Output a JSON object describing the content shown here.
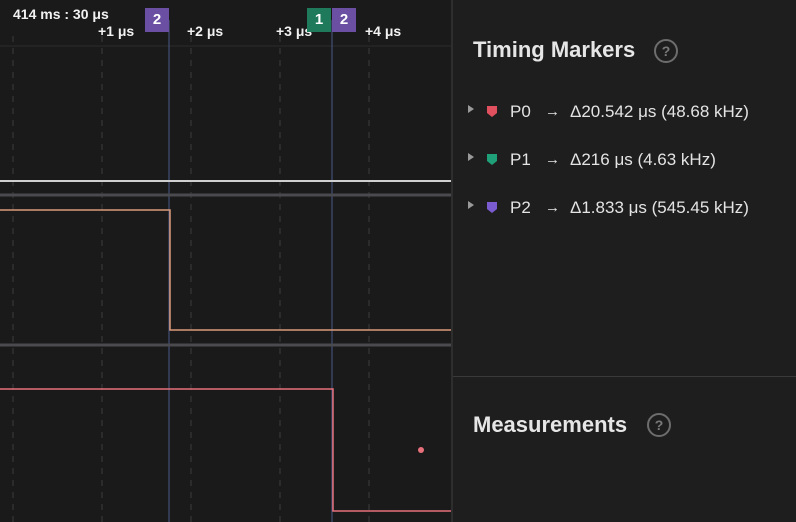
{
  "waveform": {
    "time_origin": "414 ms : 30 μs",
    "tick_labels": [
      "+1 μs",
      "+2 μs",
      "+3 μs",
      "+4 μs"
    ],
    "marker_flags": [
      {
        "label": "2",
        "color": "#6a4fa3"
      },
      {
        "label": "1",
        "color": "#1f7a5c"
      },
      {
        "label": "2",
        "color": "#6a4fa3"
      }
    ],
    "colors": {
      "background": "#1a1a1a",
      "channel_white": "#cfcfcf",
      "channel_orange": "#d99a7a",
      "channel_red": "#e8707a",
      "channel_divider": "#4a4a4f",
      "grid": "#3c3c3c",
      "marker_line": "#4a5a8a"
    }
  },
  "panel": {
    "timing_markers": {
      "title": "Timing Markers",
      "help": "?",
      "items": [
        {
          "name": "P0",
          "arrow": "→",
          "value": "Δ20.542 μs (48.68 kHz)",
          "color": "#e0505f"
        },
        {
          "name": "P1",
          "arrow": "→",
          "value": "Δ216 μs (4.63 kHz)",
          "color": "#1fa078"
        },
        {
          "name": "P2",
          "arrow": "→",
          "value": "Δ1.833 μs (545.45 kHz)",
          "color": "#7a5cd0"
        }
      ]
    },
    "measurements": {
      "title": "Measurements",
      "help": "?"
    }
  }
}
